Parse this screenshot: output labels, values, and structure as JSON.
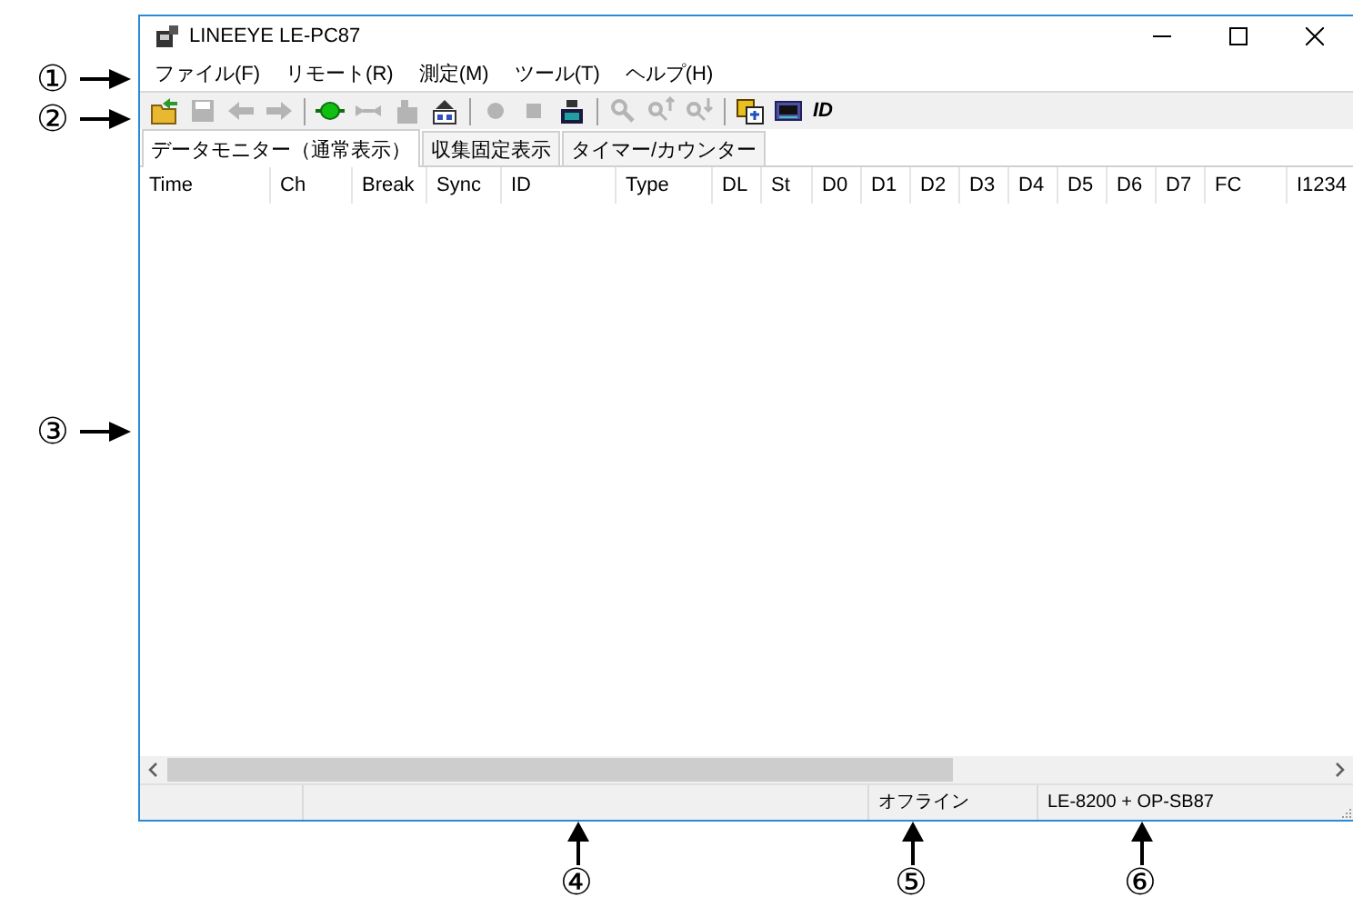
{
  "window": {
    "title": "LINEEYE LE-PC87"
  },
  "menu": [
    {
      "label": "ファイル(F)"
    },
    {
      "label": "リモート(R)"
    },
    {
      "label": "測定(M)"
    },
    {
      "label": "ツール(T)"
    },
    {
      "label": "ヘルプ(H)"
    }
  ],
  "toolbar": [
    {
      "kind": "open",
      "disabled": false
    },
    {
      "kind": "save",
      "disabled": true
    },
    {
      "kind": "back",
      "disabled": true
    },
    {
      "kind": "forward",
      "disabled": true
    },
    {
      "kind": "separator"
    },
    {
      "kind": "connect",
      "disabled": false
    },
    {
      "kind": "disconnect",
      "disabled": true
    },
    {
      "kind": "upload",
      "disabled": true
    },
    {
      "kind": "transfer",
      "disabled": false
    },
    {
      "kind": "separator"
    },
    {
      "kind": "record",
      "disabled": true
    },
    {
      "kind": "stop",
      "disabled": true
    },
    {
      "kind": "export",
      "disabled": false
    },
    {
      "kind": "separator"
    },
    {
      "kind": "zoom",
      "disabled": true
    },
    {
      "kind": "zoom-up",
      "disabled": true
    },
    {
      "kind": "zoom-down",
      "disabled": true
    },
    {
      "kind": "separator"
    },
    {
      "kind": "copy",
      "disabled": false
    },
    {
      "kind": "monitor",
      "disabled": false
    },
    {
      "kind": "text",
      "label": "ID",
      "disabled": false
    }
  ],
  "tabs": [
    {
      "label": "データモニター（通常表示）",
      "selected": true
    },
    {
      "label": "収集固定表示",
      "selected": false
    },
    {
      "label": "タイマー/カウンター",
      "selected": false
    }
  ],
  "table": {
    "columns": [
      "Time",
      "Ch",
      "Break",
      "Sync",
      "ID",
      "Type",
      "DL",
      "St",
      "D0",
      "D1",
      "D2",
      "D3",
      "D4",
      "D5",
      "D6",
      "D7",
      "FC",
      "I1234"
    ]
  },
  "status_bar": {
    "connection": "オフライン",
    "device": "LE-8200 + OP-SB87"
  },
  "callouts": [
    {
      "label": "①",
      "kind": "right"
    },
    {
      "label": "②",
      "kind": "right"
    },
    {
      "label": "③",
      "kind": "right"
    },
    {
      "label": "④",
      "kind": "up"
    },
    {
      "label": "⑤",
      "kind": "up"
    },
    {
      "label": "⑥",
      "kind": "up"
    }
  ]
}
